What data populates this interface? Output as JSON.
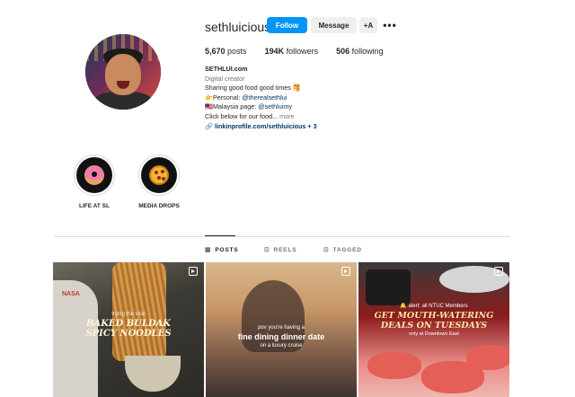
{
  "profile": {
    "username": "sethluicious",
    "follow_label": "Follow",
    "message_label": "Message",
    "suggest_label": "+A",
    "more_label": "•••",
    "stats": {
      "posts_count": "5,670",
      "posts_label": "posts",
      "followers_count": "194K",
      "followers_label": "followers",
      "following_count": "506",
      "following_label": "following"
    },
    "bio": {
      "name": "SETHLUI.com",
      "category": "Digital creator",
      "line1": "Sharing good food good times 🥞",
      "personal_prefix": "👉Personal: ",
      "personal_handle": "@therealsethlui",
      "malaysia_prefix": "🇲🇾Malaysia page: ",
      "malaysia_handle": "@sethluimy",
      "line4": "Click below for our food... ",
      "more": "more",
      "link": "🔗 linkinprofile.com/sethluicious + 3"
    }
  },
  "highlights": [
    {
      "label": "LIFE AT SL",
      "icon": "donut-icon"
    },
    {
      "label": "MEDIA DROPS",
      "icon": "pizza-icon"
    }
  ],
  "tabs": [
    {
      "label": "POSTS",
      "icon": "▦",
      "active": true
    },
    {
      "label": "REELS",
      "icon": "⊡",
      "active": false
    },
    {
      "label": "TAGGED",
      "icon": "⊡",
      "active": false
    }
  ],
  "posts": [
    {
      "small": "trying the viral",
      "big1": "BAKED BULDAK",
      "big2": "SPICY NOODLES",
      "brand": "NASA"
    },
    {
      "small": "pov you're having a",
      "big": "fine dining dinner date",
      "small2": "on a luxury cruise"
    },
    {
      "alert": "🔔 alert: all NTUC Members",
      "big1": "GET MOUTH-WATERING",
      "big2": "DEALS ON TUESDAYS",
      "small2": "only at Downtown East"
    }
  ],
  "colors": {
    "follow_button": "#0095f6",
    "link": "#00376b",
    "muted_text": "#737373",
    "divider": "#dbdbdb"
  }
}
